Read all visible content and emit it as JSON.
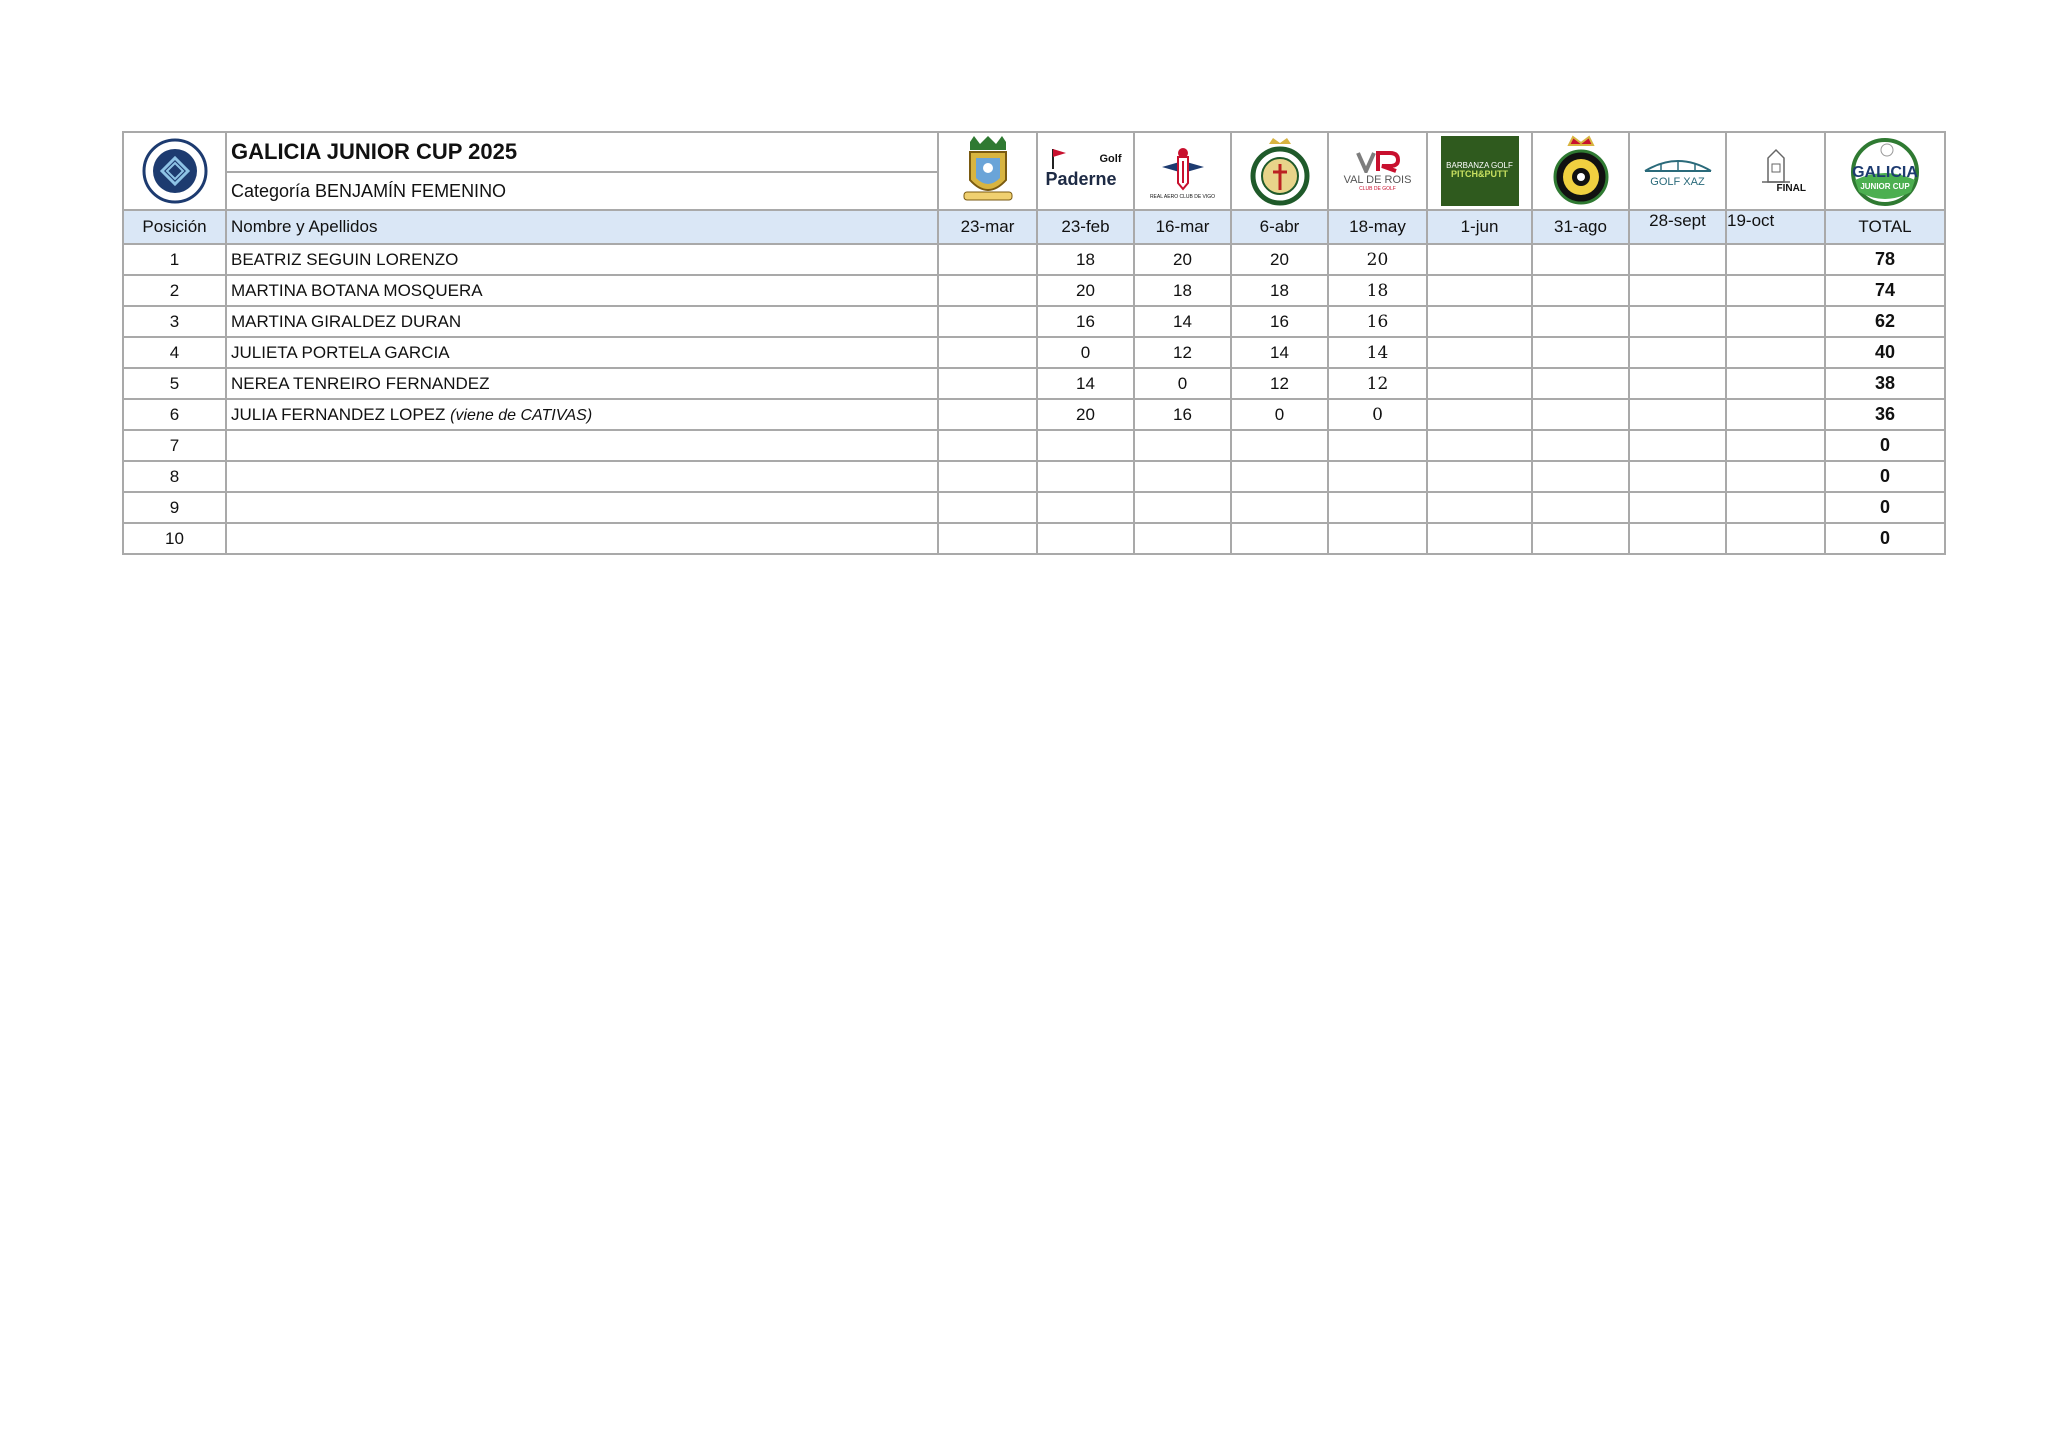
{
  "header": {
    "title": "GALICIA JUNIOR CUP 2025",
    "category": "Categoría BENJAMÍN FEMENINO"
  },
  "logos": {
    "federation": "federation-logo",
    "club_1": "crest-logo",
    "club_2_text_small": "Golf",
    "club_2_text": "Paderne",
    "club_3_text": "REAL AERO CLUB DE VIGO",
    "club_5_text": "VAL DE ROIS",
    "club_5_sub": "CLUB DE GOLF",
    "club_6_text": "BARBANZA GOLF",
    "club_6_sub": "PITCH&PUTT",
    "club_8_text": "GOLF XAZ",
    "club_9_text": "FINAL",
    "total_logo_top": "GALICIA",
    "total_logo_bottom": "JUNIOR CUP"
  },
  "columns": {
    "position": "Posición",
    "name": "Nombre y Apellidos",
    "dates": [
      "23-mar",
      "23-feb",
      "16-mar",
      "6-abr",
      "18-may",
      "1-jun",
      "31-ago",
      "28-sept",
      "19-oct"
    ],
    "total": "TOTAL"
  },
  "rows": [
    {
      "pos": "1",
      "name": "BEATRIZ SEGUIN LORENZO",
      "note": "",
      "scores": [
        "",
        "18",
        "20",
        "20",
        "20",
        "",
        "",
        "",
        ""
      ],
      "total": "78"
    },
    {
      "pos": "2",
      "name": "MARTINA BOTANA MOSQUERA",
      "note": "",
      "scores": [
        "",
        "20",
        "18",
        "18",
        "18",
        "",
        "",
        "",
        ""
      ],
      "total": "74"
    },
    {
      "pos": "3",
      "name": "MARTINA GIRALDEZ DURAN",
      "note": "",
      "scores": [
        "",
        "16",
        "14",
        "16",
        "16",
        "",
        "",
        "",
        ""
      ],
      "total": "62"
    },
    {
      "pos": "4",
      "name": "JULIETA PORTELA GARCIA",
      "note": "",
      "scores": [
        "",
        "0",
        "12",
        "14",
        "14",
        "",
        "",
        "",
        ""
      ],
      "total": "40"
    },
    {
      "pos": "5",
      "name": "NEREA TENREIRO FERNANDEZ",
      "note": "",
      "scores": [
        "",
        "14",
        "0",
        "12",
        "12",
        "",
        "",
        "",
        ""
      ],
      "total": "38"
    },
    {
      "pos": "6",
      "name": "JULIA FERNANDEZ LOPEZ",
      "note": "(viene de CATIVAS)",
      "scores": [
        "",
        "20",
        "16",
        "0",
        "0",
        "",
        "",
        "",
        ""
      ],
      "total": "36"
    },
    {
      "pos": "7",
      "name": "",
      "note": "",
      "scores": [
        "",
        "",
        "",
        "",
        "",
        "",
        "",
        "",
        ""
      ],
      "total": "0"
    },
    {
      "pos": "8",
      "name": "",
      "note": "",
      "scores": [
        "",
        "",
        "",
        "",
        "",
        "",
        "",
        "",
        ""
      ],
      "total": "0"
    },
    {
      "pos": "9",
      "name": "",
      "note": "",
      "scores": [
        "",
        "",
        "",
        "",
        "",
        "",
        "",
        "",
        ""
      ],
      "total": "0"
    },
    {
      "pos": "10",
      "name": "",
      "note": "",
      "scores": [
        "",
        "",
        "",
        "",
        "",
        "",
        "",
        "",
        ""
      ],
      "total": "0"
    }
  ],
  "colors": {
    "header_fill": "#dae7f6",
    "grid": "#a9a9a9",
    "green_dark": "#1f5a2a",
    "navy": "#1d3b70"
  }
}
